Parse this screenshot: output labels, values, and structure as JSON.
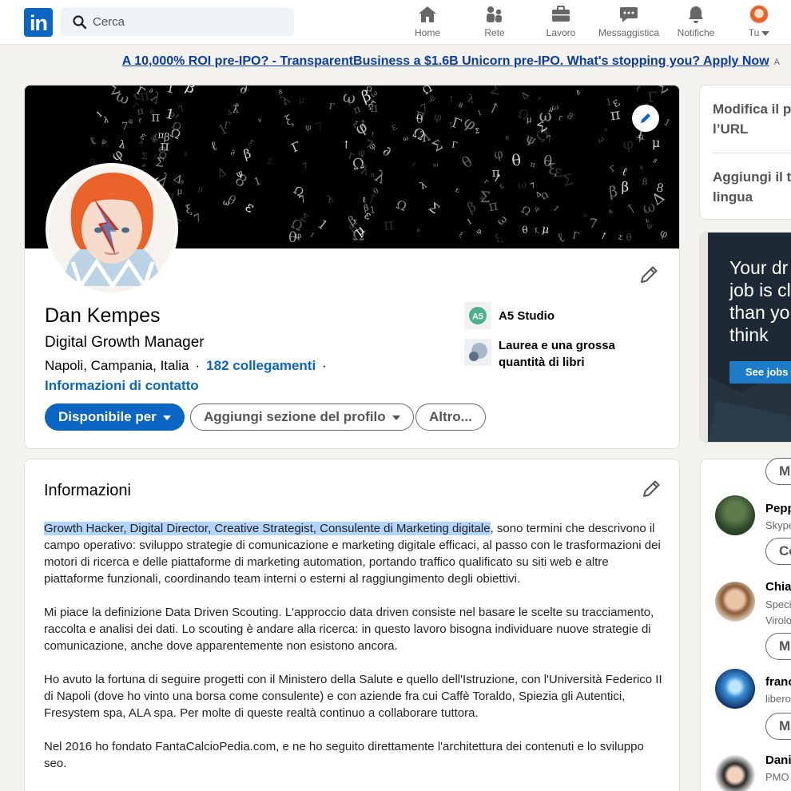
{
  "nav": {
    "logo": "in",
    "search_placeholder": "Cerca",
    "items": [
      {
        "label": "Home",
        "icon": "home-icon"
      },
      {
        "label": "Rete",
        "icon": "network-icon"
      },
      {
        "label": "Lavoro",
        "icon": "briefcase-icon"
      },
      {
        "label": "Messaggistica",
        "icon": "messaging-icon"
      },
      {
        "label": "Notifiche",
        "icon": "bell-icon"
      },
      {
        "label": "Tu",
        "icon": "avatar"
      }
    ]
  },
  "promo": {
    "text": "A 10,000% ROI pre-IPO? - TransparentBusiness a $1.6B Unicorn pre-IPO. What's stopping you? Apply Now",
    "ad_label": "A"
  },
  "profile": {
    "name": "Dan Kempes",
    "headline": "Digital Growth Manager",
    "location": "Napoli, Campania, Italia",
    "connections": "182 collegamenti",
    "contact_info": "Informazioni di contatto",
    "buttons": {
      "open_to": "Disponibile per",
      "add_section": "Aggiungi sezione del profilo",
      "more": "Altro..."
    },
    "company": "A5 Studio",
    "company_logo_text": "A5",
    "education": "Laurea e una grossa quantità di libri"
  },
  "about": {
    "title": "Informazioni",
    "highlight": "Growth Hacker, Digital Director, Creative Strategist, Consulente di Marketing digitale",
    "p1_rest": ", sono termini che descrivono il campo operativo: sviluppo strategie di comunicazione e marketing digitale efficaci, al passo con le trasformazioni dei motori di ricerca e delle piattaforme di marketing automation, portando traffico qualificato su siti web e altre piattaforme funzionali, coordinando team interni o esterni al raggiungimento degli obiettivi.",
    "p2": "Mi piace la definizione Data Driven Scouting. L'approccio data driven consiste nel basare le scelte su tracciamento, raccolta e analisi dei dati. Lo scouting è andare alla ricerca: in questo lavoro bisogna individuare nuove strategie di comunicazione, anche dove apparentemente non esistono ancora.",
    "p3": "Ho avuto la fortuna di seguire progetti con il Ministero della Salute e quello dell'Istruzione, con l'Università Federico II di Napoli (dove ho vinto una borsa come consulente) e con aziende fra cui Caffè Toraldo, Spiezia gli Autentici, Fresystem spa, ALA spa. Per molte di queste realtà continuo a collaborare tuttora.",
    "p4": "Nel 2016 ho fondato FantaCalcioPedia.com, e ne ho seguito direttamente l'architettura dei contenuti e lo sviluppo seo."
  },
  "right": {
    "edit_url": "Modifica il pr l’URL",
    "edit_url_line1": "Modifica il pr",
    "edit_url_line2": "l’URL",
    "add_lang_line1": "Aggiungi il tu",
    "add_lang_line2": "lingua",
    "ad_lines": [
      "Your dr",
      "job is cl",
      "than yo",
      "think"
    ],
    "ad_button": "See jobs",
    "people": [
      {
        "name": "Pepp",
        "sub": "Skype",
        "button": "Co"
      },
      {
        "name": "Chia",
        "sub": "Speci",
        "sub2": "Virolo",
        "button": "M"
      },
      {
        "name": "franc",
        "sub": "libero",
        "button": "M"
      },
      {
        "name": "Dani",
        "sub": "PMO"
      }
    ],
    "top_button": "M"
  },
  "colors": {
    "brand": "#0a66c2",
    "background": "#f3f2ef",
    "highlight": "#b3d4fc",
    "promo_link": "#0a3ca8"
  }
}
